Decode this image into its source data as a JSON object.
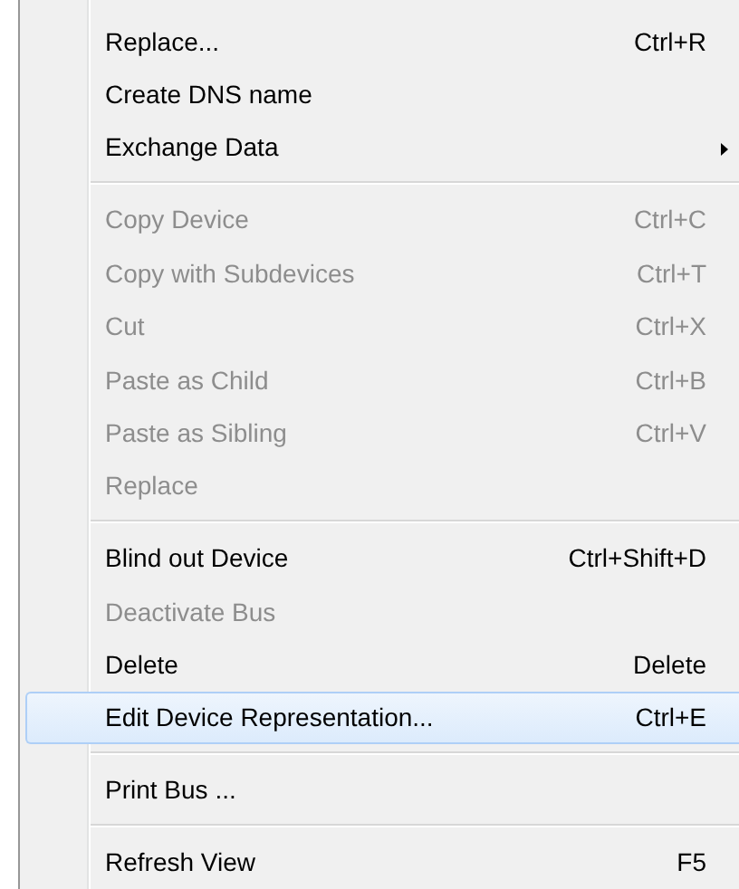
{
  "menu": {
    "groups": [
      {
        "items": [
          {
            "label": "Replace...",
            "shortcut": "Ctrl+R",
            "disabled": false,
            "selected": false,
            "submenu": false
          },
          {
            "label": "Create DNS name",
            "disabled": false,
            "selected": false,
            "submenu": false
          },
          {
            "label": "Exchange Data",
            "disabled": false,
            "selected": false,
            "submenu": true
          }
        ]
      },
      {
        "items": [
          {
            "label": "Copy Device",
            "shortcut": "Ctrl+C",
            "disabled": true,
            "selected": false,
            "submenu": false
          },
          {
            "label": "Copy with Subdevices",
            "shortcut": "Ctrl+T",
            "disabled": true,
            "selected": false,
            "submenu": false
          },
          {
            "label": "Cut",
            "shortcut": "Ctrl+X",
            "disabled": true,
            "selected": false,
            "submenu": false
          },
          {
            "label": "Paste as Child",
            "shortcut": "Ctrl+B",
            "disabled": true,
            "selected": false,
            "submenu": false
          },
          {
            "label": "Paste as Sibling",
            "shortcut": "Ctrl+V",
            "disabled": true,
            "selected": false,
            "submenu": false
          },
          {
            "label": "Replace",
            "disabled": true,
            "selected": false,
            "submenu": false
          }
        ]
      },
      {
        "items": [
          {
            "label": "Blind out Device",
            "shortcut": "Ctrl+Shift+D",
            "disabled": false,
            "selected": false,
            "submenu": false
          },
          {
            "label": "Deactivate Bus",
            "disabled": true,
            "selected": false,
            "submenu": false
          },
          {
            "label": "Delete",
            "shortcut": "Delete",
            "disabled": false,
            "selected": false,
            "submenu": false
          },
          {
            "label": "Edit Device Representation...",
            "shortcut": "Ctrl+E",
            "disabled": false,
            "selected": true,
            "submenu": false
          }
        ]
      },
      {
        "items": [
          {
            "label": "Print Bus ...",
            "disabled": false,
            "selected": false,
            "submenu": false
          }
        ]
      },
      {
        "items": [
          {
            "label": "Refresh View",
            "shortcut": "F5",
            "disabled": false,
            "selected": false,
            "submenu": false
          }
        ]
      }
    ]
  }
}
